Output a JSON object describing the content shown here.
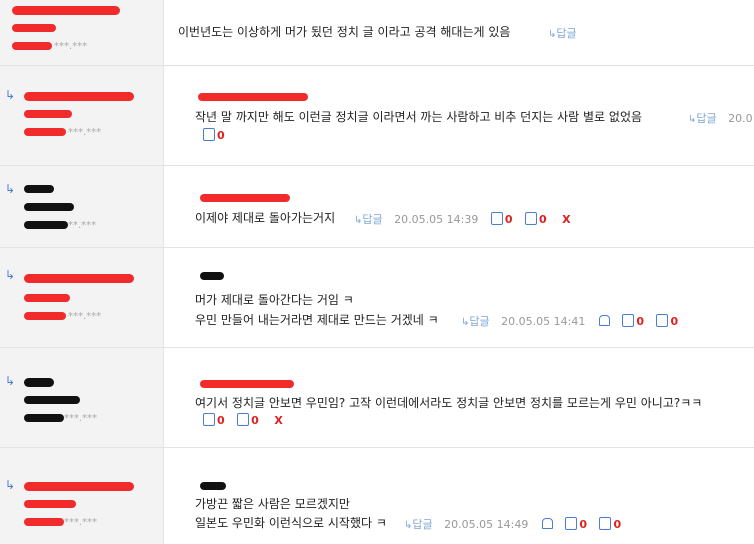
{
  "comments": [
    {
      "ip": "***.***",
      "lines": [
        "이번년도는 이상하게 머가 됬던 정치 글 이라고 공격 해대는게 있음"
      ],
      "reply_label": "답글"
    },
    {
      "ip": "***.***",
      "lines": [
        "작년 말 까지만 해도 이런글 정치글 이라면서 까는 사람하고 비추 던지는 사람 별로 없었음"
      ],
      "reply_label": "답글",
      "date": "20.0",
      "down": "0"
    },
    {
      "ip": "**.***",
      "lines": [
        "이제야 제대로 돌아가는거지"
      ],
      "reply_label": "답글",
      "date": "20.05.05 14:39",
      "up": "0",
      "down": "0",
      "delete": "X"
    },
    {
      "ip": "***.***",
      "lines": [
        "머가 제대로 돌아간다는 거임 ㅋ",
        "우민 만들어 내는거라면 제대로 만드는 거겠네 ㅋ"
      ],
      "reply_label": "답글",
      "date": "20.05.05 14:41",
      "up": "0",
      "down": "0"
    },
    {
      "ip": "***.***",
      "lines": [
        "여기서 정치글 안보면 우민임? 고작 이런데에서라도 정치글 안보면 정치를 모르는게 우민 아니고?ㅋㅋ"
      ],
      "up": "0",
      "down": "0",
      "delete": "X"
    },
    {
      "ip": "***.***",
      "lines": [
        "가방끈 짧은 사람은 모르겠지만",
        "일본도 우민화 이런식으로 시작했다 ㅋ"
      ],
      "reply_label": "답글",
      "date": "20.05.05 14:49",
      "up": "0",
      "down": "0"
    }
  ]
}
